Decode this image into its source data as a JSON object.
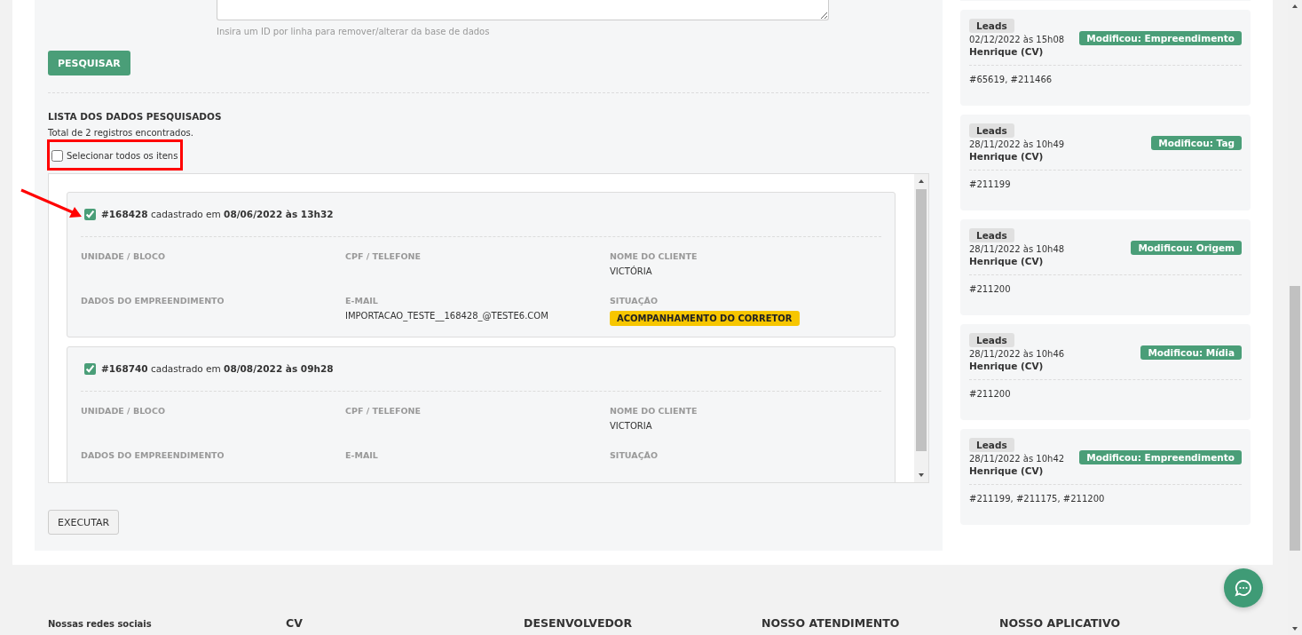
{
  "search_form": {
    "hint": "Insira um ID por linha para remover/alterar da base de dados",
    "search_button": "PESQUISAR"
  },
  "results": {
    "title": "LISTA DOS DADOS PESQUISADOS",
    "total": "Total de 2 registros encontrados.",
    "select_all": {
      "label": "Selecionar todos os itens",
      "checked": false
    },
    "records": [
      {
        "id": "#168428",
        "registered": "cadastrado em",
        "date": "08/06/2022 às 13h32",
        "checked": true,
        "fields": [
          {
            "label": "UNIDADE / BLOCO"
          },
          {
            "label": "CPF / TELEFONE"
          },
          {
            "label": "NOME DO CLIENTE",
            "value": "VICTÓRIA",
            "kind": "text"
          },
          {
            "label": "DADOS DO EMPREENDIMENTO"
          },
          {
            "label": "E-MAIL",
            "value": "IMPORTACAO_TESTE__168428_@TESTE6.COM",
            "kind": "text"
          },
          {
            "label": "SITUAÇÃO",
            "value": "ACOMPANHAMENTO DO CORRETOR",
            "kind": "badge"
          }
        ]
      },
      {
        "id": "#168740",
        "registered": "cadastrado em",
        "date": "08/08/2022 às 09h28",
        "checked": true,
        "fields": [
          {
            "label": "UNIDADE / BLOCO"
          },
          {
            "label": "CPF / TELEFONE"
          },
          {
            "label": "NOME DO CLIENTE",
            "value": "VICTORIA",
            "kind": "text"
          },
          {
            "label": "DADOS DO EMPREENDIMENTO"
          },
          {
            "label": "E-MAIL"
          },
          {
            "label": "SITUAÇÃO"
          }
        ]
      }
    ],
    "execute_button": "EXECUTAR"
  },
  "history": [
    {
      "module": "Leads",
      "date": "02/12/2022 às 15h08",
      "user": "Henrique (CV)",
      "action": "Modificou: Empreendimento",
      "ids": "#65619, #211466"
    },
    {
      "module": "Leads",
      "date": "28/11/2022 às 10h49",
      "user": "Henrique (CV)",
      "action": "Modificou: Tag",
      "ids": "#211199"
    },
    {
      "module": "Leads",
      "date": "28/11/2022 às 10h48",
      "user": "Henrique (CV)",
      "action": "Modificou: Origem",
      "ids": "#211200"
    },
    {
      "module": "Leads",
      "date": "28/11/2022 às 10h46",
      "user": "Henrique (CV)",
      "action": "Modificou: Mídia",
      "ids": "#211200"
    },
    {
      "module": "Leads",
      "date": "28/11/2022 às 10h42",
      "user": "Henrique (CV)",
      "action": "Modificou: Empreendimento",
      "ids": "#211199, #211175, #211200"
    }
  ],
  "footer": {
    "columns": [
      {
        "title": "Nossas redes sociais",
        "kind": "small"
      },
      {
        "title": "CV",
        "kind": "large"
      },
      {
        "title": "DESENVOLVEDOR",
        "kind": "large"
      },
      {
        "title": "NOSSO ATENDIMENTO",
        "kind": "large"
      },
      {
        "title": "NOSSO APLICATIVO",
        "kind": "large"
      }
    ]
  }
}
